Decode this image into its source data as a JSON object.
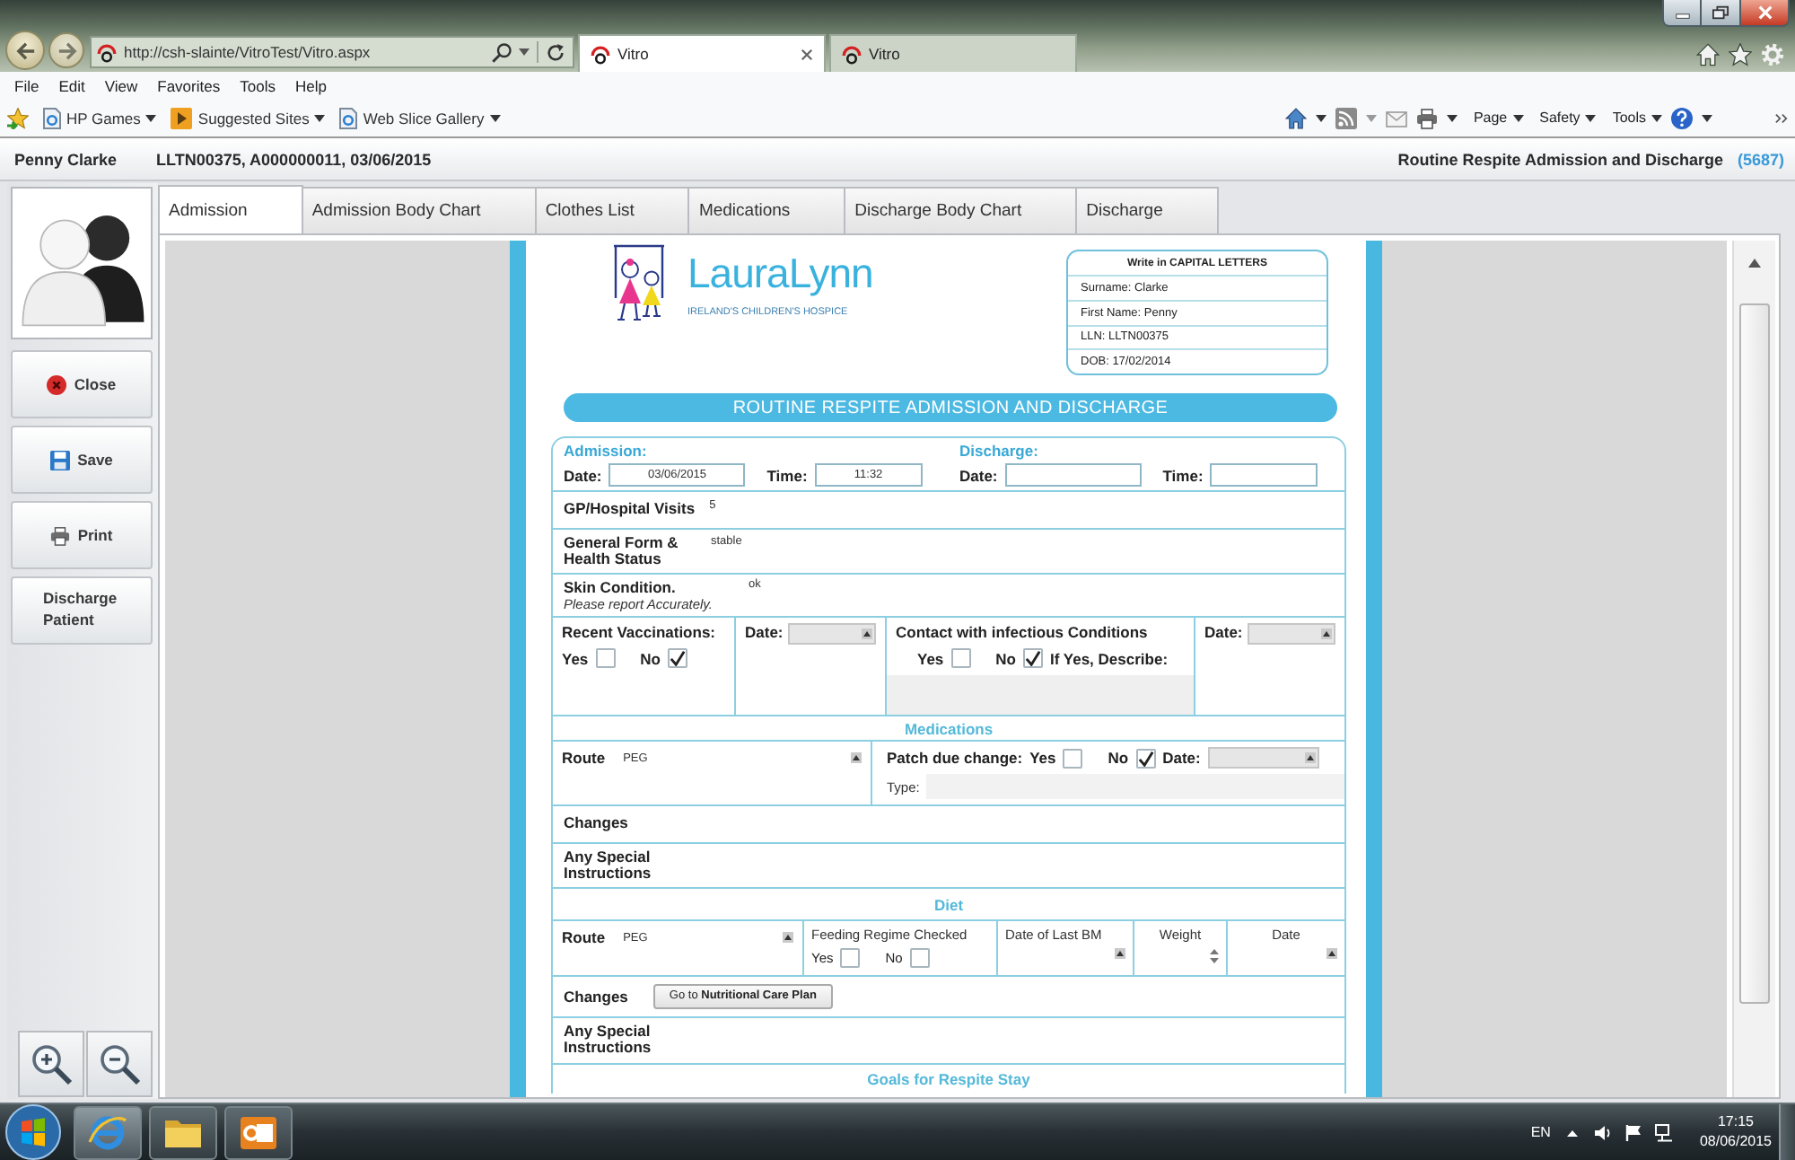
{
  "browser": {
    "address": "http://csh-slainte/VitroTest/Vitro.aspx",
    "tabs": [
      {
        "label": "Vitro",
        "selected": true
      },
      {
        "label": "Vitro",
        "selected": false
      }
    ],
    "menu": [
      "File",
      "Edit",
      "View",
      "Favorites",
      "Tools",
      "Help"
    ],
    "favorites": [
      {
        "label": "HP Games",
        "kind": "page"
      },
      {
        "label": "Suggested Sites",
        "kind": "tile"
      },
      {
        "label": "Web Slice Gallery",
        "kind": "page"
      }
    ],
    "commands": [
      "Page",
      "Safety",
      "Tools"
    ]
  },
  "header": {
    "patient": "Penny Clarke",
    "details": "LLTN00375, A000000011, 03/06/2015",
    "form_title": "Routine Respite Admission and Discharge",
    "form_number": "(5687)"
  },
  "sidebar": {
    "buttons": [
      {
        "label": "Close",
        "kind": "close"
      },
      {
        "label": "Save",
        "kind": "save"
      },
      {
        "label": "Print",
        "kind": "print"
      },
      {
        "label": "Discharge Patient",
        "kind": "text"
      }
    ]
  },
  "tabs": [
    {
      "label": "Admission",
      "selected": true
    },
    {
      "label": "Admission Body Chart",
      "selected": false
    },
    {
      "label": "Clothes List",
      "selected": false
    },
    {
      "label": "Medications",
      "selected": false
    },
    {
      "label": "Discharge Body Chart",
      "selected": false
    },
    {
      "label": "Discharge",
      "selected": false
    }
  ],
  "form": {
    "logo": {
      "name": "LauraLynn",
      "tagline": "IRELAND'S CHILDREN'S HOSPICE"
    },
    "info_box": {
      "heading": "Write in CAPITAL LETTERS",
      "lines": [
        "Surname: Clarke",
        "First Name: Penny",
        "LLN: LLTN00375",
        "DOB: 17/02/2014"
      ]
    },
    "title": "ROUTINE RESPITE ADMISSION AND DISCHARGE",
    "admission": {
      "heading": "Admission:",
      "date_label": "Date:",
      "date": "03/06/2015",
      "time_label": "Time:",
      "time": "11:32"
    },
    "discharge": {
      "heading": "Discharge:",
      "date_label": "Date:",
      "time_label": "Time:"
    },
    "gp_visits": {
      "label": "GP/Hospital Visits",
      "value": "5"
    },
    "general": {
      "label": "General Form & Health Status",
      "value": "stable"
    },
    "skin": {
      "label": "Skin Condition.",
      "note": "Please report Accurately.",
      "value": "ok"
    },
    "vaccinations": {
      "label": "Recent Vaccinations:",
      "yes": {
        "label": "Yes",
        "checked": false
      },
      "no": {
        "label": "No",
        "checked": true
      },
      "date_label": "Date:"
    },
    "contact": {
      "label": "Contact with infectious Conditions",
      "yes": {
        "label": "Yes",
        "checked": false
      },
      "no": {
        "label": "No",
        "checked": true
      },
      "describe_label": "If Yes, Describe:",
      "date_label": "Date:"
    },
    "medications": {
      "heading": "Medications",
      "route_label": "Route",
      "route": "PEG",
      "patch_label": "Patch due change:",
      "yes": {
        "label": "Yes",
        "checked": false
      },
      "no": {
        "label": "No",
        "checked": true
      },
      "date_label": "Date:",
      "type_label": "Type:",
      "changes_label": "Changes",
      "instructions_label": "Any Special Instructions"
    },
    "diet": {
      "heading": "Diet",
      "route_label": "Route",
      "route": "PEG",
      "feeding_label": "Feeding Regime Checked",
      "yes": {
        "label": "Yes",
        "checked": false
      },
      "no": {
        "label": "No",
        "checked": false
      },
      "last_bm_label": "Date of Last BM",
      "weight_label": "Weight",
      "date_label": "Date",
      "changes_label": "Changes",
      "care_plan_button": "Go to **Nutritional Care Plan**",
      "instructions_label": "Any Special Instructions"
    },
    "goals": {
      "heading": "Goals for Respite Stay"
    }
  },
  "taskbar": {
    "apps": [
      {
        "kind": "browser"
      },
      {
        "kind": "folder"
      },
      {
        "kind": "mail"
      }
    ],
    "language": "EN",
    "time": "17:15",
    "date": "08/06/2015"
  }
}
